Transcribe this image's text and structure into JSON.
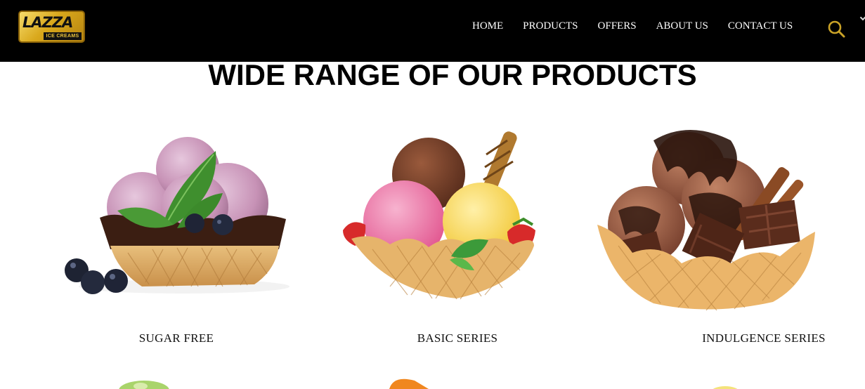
{
  "header": {
    "logo": {
      "word": "LAZZA",
      "sub": "ICE CREAMS"
    },
    "nav": [
      {
        "label": "HOME"
      },
      {
        "label": "PRODUCTS"
      },
      {
        "label": "OFFERS"
      },
      {
        "label": "ABOUT US"
      },
      {
        "label": "CONTACT US"
      }
    ],
    "search_icon": "search-icon"
  },
  "main": {
    "title": "WIDE RANGE OF OUR PRODUCTS",
    "products": [
      {
        "label": "SUGAR FREE",
        "image": "sugar-free-ice-cream-image"
      },
      {
        "label": "BASIC SERIES",
        "image": "basic-series-ice-cream-image"
      },
      {
        "label": "INDULGENCE SERIES",
        "image": "indulgence-series-ice-cream-image"
      }
    ]
  },
  "colors": {
    "header_bg": "#000000",
    "nav_text": "#ffffff",
    "search_accent": "#c9a227",
    "logo_gold": "#d9a81c"
  }
}
